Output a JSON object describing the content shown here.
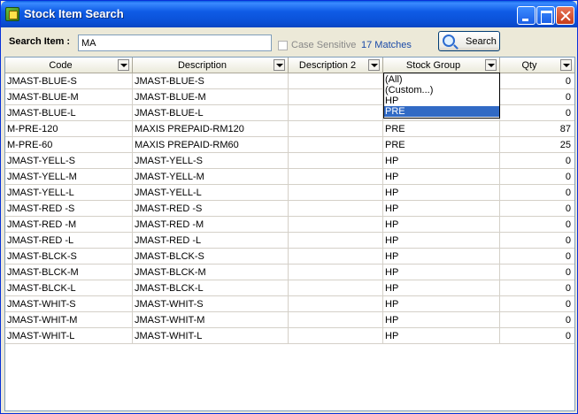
{
  "window": {
    "title": "Stock Item Search"
  },
  "search": {
    "label": "Search Item :",
    "value": "MA",
    "case_sensitive_label": "Case Sensitive",
    "matches": "17 Matches",
    "button_label": "Search"
  },
  "columns": [
    "Code",
    "Description",
    "Description 2",
    "Stock Group",
    "Qty"
  ],
  "rows": [
    {
      "code": "JMAST-BLUE-S",
      "description": "JMAST-BLUE-S",
      "description2": "",
      "stock_group": "",
      "qty": "0"
    },
    {
      "code": "JMAST-BLUE-M",
      "description": "JMAST-BLUE-M",
      "description2": "",
      "stock_group": "",
      "qty": "0"
    },
    {
      "code": "JMAST-BLUE-L",
      "description": "JMAST-BLUE-L",
      "description2": "",
      "stock_group": "",
      "qty": "0"
    },
    {
      "code": "M-PRE-120",
      "description": "MAXIS PREPAID-RM120",
      "description2": "",
      "stock_group": "PRE",
      "qty": "87"
    },
    {
      "code": "M-PRE-60",
      "description": "MAXIS PREPAID-RM60",
      "description2": "",
      "stock_group": "PRE",
      "qty": "25"
    },
    {
      "code": "JMAST-YELL-S",
      "description": "JMAST-YELL-S",
      "description2": "",
      "stock_group": "HP",
      "qty": "0"
    },
    {
      "code": "JMAST-YELL-M",
      "description": "JMAST-YELL-M",
      "description2": "",
      "stock_group": "HP",
      "qty": "0"
    },
    {
      "code": "JMAST-YELL-L",
      "description": "JMAST-YELL-L",
      "description2": "",
      "stock_group": "HP",
      "qty": "0"
    },
    {
      "code": "JMAST-RED -S",
      "description": "JMAST-RED -S",
      "description2": "",
      "stock_group": "HP",
      "qty": "0"
    },
    {
      "code": "JMAST-RED -M",
      "description": "JMAST-RED -M",
      "description2": "",
      "stock_group": "HP",
      "qty": "0"
    },
    {
      "code": "JMAST-RED -L",
      "description": "JMAST-RED -L",
      "description2": "",
      "stock_group": "HP",
      "qty": "0"
    },
    {
      "code": "JMAST-BLCK-S",
      "description": "JMAST-BLCK-S",
      "description2": "",
      "stock_group": "HP",
      "qty": "0"
    },
    {
      "code": "JMAST-BLCK-M",
      "description": "JMAST-BLCK-M",
      "description2": "",
      "stock_group": "HP",
      "qty": "0"
    },
    {
      "code": "JMAST-BLCK-L",
      "description": "JMAST-BLCK-L",
      "description2": "",
      "stock_group": "HP",
      "qty": "0"
    },
    {
      "code": "JMAST-WHIT-S",
      "description": "JMAST-WHIT-S",
      "description2": "",
      "stock_group": "HP",
      "qty": "0"
    },
    {
      "code": "JMAST-WHIT-M",
      "description": "JMAST-WHIT-M",
      "description2": "",
      "stock_group": "HP",
      "qty": "0"
    },
    {
      "code": "JMAST-WHIT-L",
      "description": "JMAST-WHIT-L",
      "description2": "",
      "stock_group": "HP",
      "qty": "0"
    }
  ],
  "stock_group_filter": {
    "options": [
      "(All)",
      "(Custom...)",
      "HP",
      "PRE"
    ],
    "selected": "PRE"
  },
  "colors": {
    "title_bar": "#0a4fd6",
    "selection": "#316ac5",
    "matches_text": "#1a4aa8"
  }
}
